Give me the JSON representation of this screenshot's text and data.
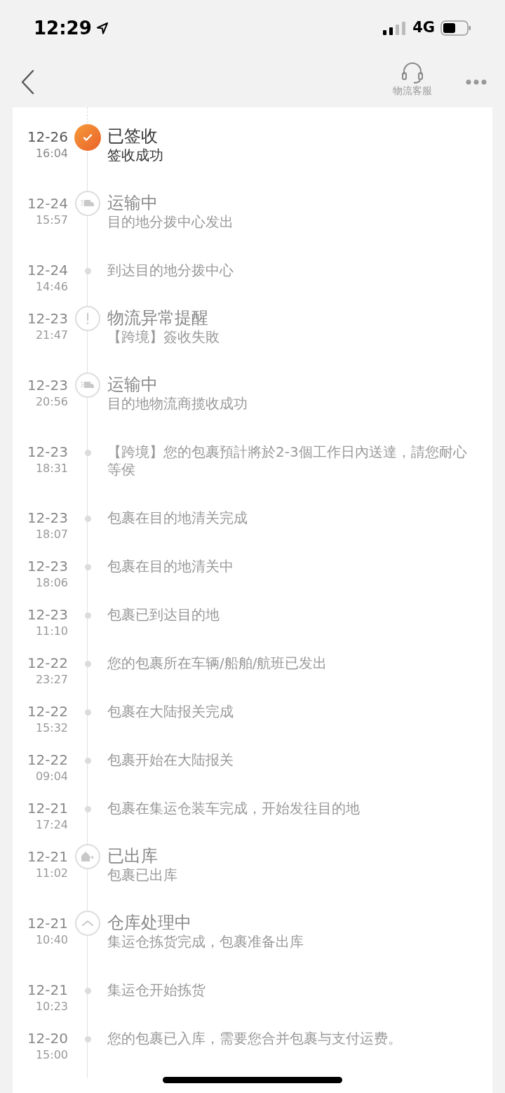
{
  "status_bar": {
    "time": "12:29",
    "network": "4G"
  },
  "header": {
    "service_label": "物流客服"
  },
  "events": [
    {
      "kind": "done",
      "current": true,
      "date": "12-26",
      "time": "16:04",
      "title": "已签收",
      "text": "签收成功"
    },
    {
      "kind": "truck",
      "current": false,
      "date": "12-24",
      "time": "15:57",
      "title": "运输中",
      "text": "目的地分拨中心发出"
    },
    {
      "kind": "dot",
      "current": false,
      "date": "12-24",
      "time": "14:46",
      "text": "到达目的地分拨中心"
    },
    {
      "kind": "alert",
      "current": false,
      "date": "12-23",
      "time": "21:47",
      "title": "物流异常提醒",
      "text": "【跨境】簽收失敗"
    },
    {
      "kind": "truck",
      "current": false,
      "date": "12-23",
      "time": "20:56",
      "title": "运输中",
      "text": "目的地物流商揽收成功"
    },
    {
      "kind": "dot",
      "current": false,
      "date": "12-23",
      "time": "18:31",
      "text": "【跨境】您的包裹預計將於2-3個工作日內送達，請您耐心等侯"
    },
    {
      "kind": "dot",
      "current": false,
      "date": "12-23",
      "time": "18:07",
      "text": "包裹在目的地清关完成"
    },
    {
      "kind": "dot",
      "current": false,
      "date": "12-23",
      "time": "18:06",
      "text": "包裹在目的地清关中"
    },
    {
      "kind": "dot",
      "current": false,
      "date": "12-23",
      "time": "11:10",
      "text": "包裹已到达目的地"
    },
    {
      "kind": "dot",
      "current": false,
      "date": "12-22",
      "time": "23:27",
      "text": "您的包裹所在车辆/船舶/航班已发出"
    },
    {
      "kind": "dot",
      "current": false,
      "date": "12-22",
      "time": "15:32",
      "text": "包裹在大陆报关完成"
    },
    {
      "kind": "dot",
      "current": false,
      "date": "12-22",
      "time": "09:04",
      "text": "包裹开始在大陆报关"
    },
    {
      "kind": "dot",
      "current": false,
      "date": "12-21",
      "time": "17:24",
      "text": "包裹在集运仓装车完成，开始发往目的地"
    },
    {
      "kind": "house",
      "current": false,
      "date": "12-21",
      "time": "11:02",
      "title": "已出库",
      "text": "包裹已出库"
    },
    {
      "kind": "warehouse",
      "current": false,
      "date": "12-21",
      "time": "10:40",
      "title": "仓库处理中",
      "text": "集运仓拣货完成，包裹准备出库"
    },
    {
      "kind": "dot",
      "current": false,
      "date": "12-21",
      "time": "10:23",
      "text": "集运仓开始拣货"
    },
    {
      "kind": "dot",
      "current": false,
      "date": "12-20",
      "time": "15:00",
      "text": "您的包裹已入库，需要您合并包裹与支付运费。"
    }
  ]
}
